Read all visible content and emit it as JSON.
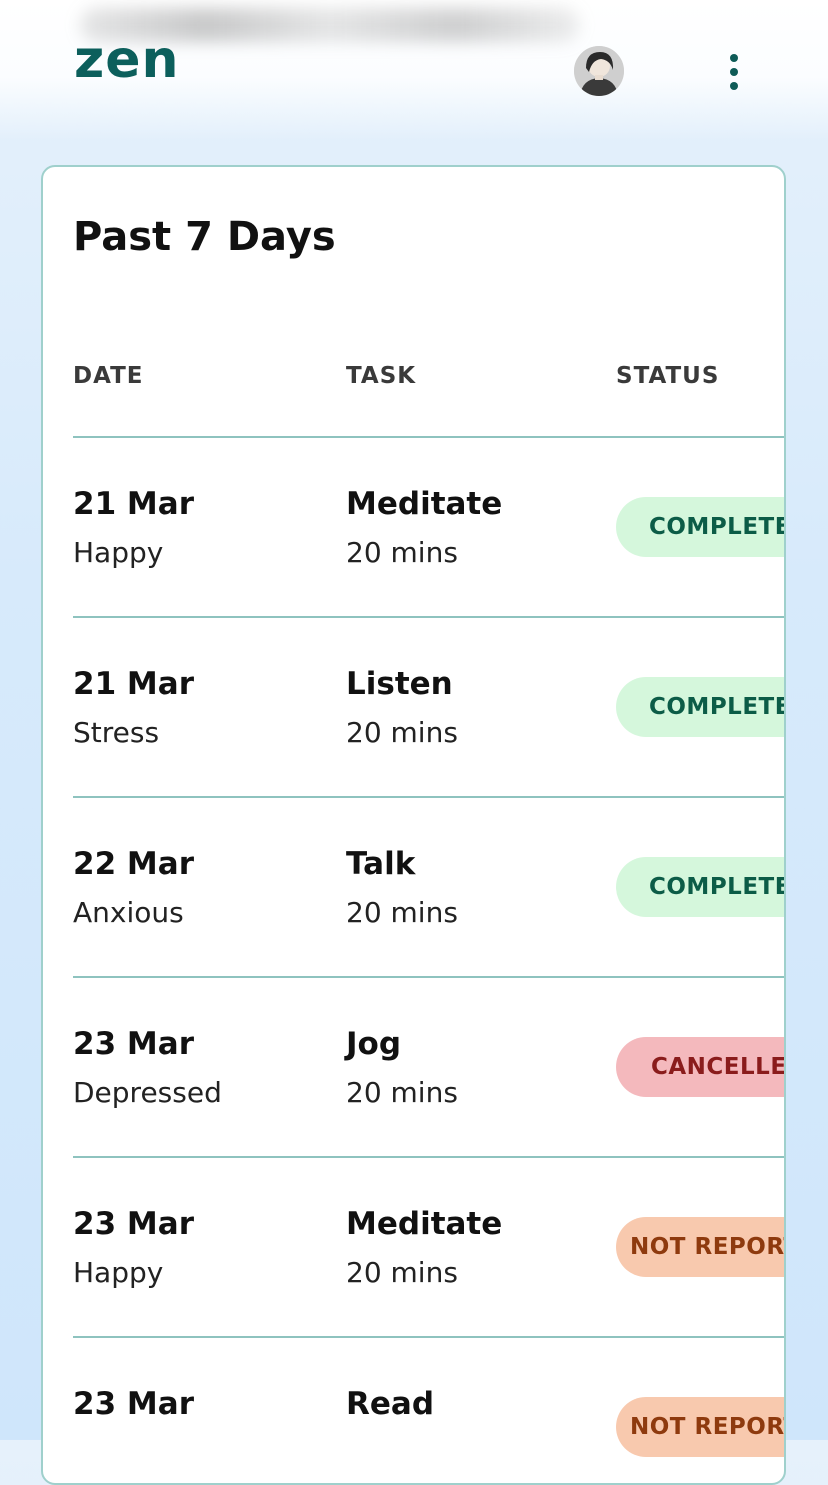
{
  "app": {
    "logo_text": "zen",
    "brand_color": "#0c5f5c"
  },
  "header": {
    "avatar_icon": "user-avatar",
    "menu_icon": "more-vertical-icon"
  },
  "card": {
    "title": "Past 7 Days",
    "columns": {
      "date": "DATE",
      "task": "TASK",
      "status": "STATUS"
    },
    "rows": [
      {
        "date": "21 Mar",
        "mood": "Happy",
        "task": "Meditate",
        "duration": "20 mins",
        "status": "COMPLETED",
        "status_type": "completed"
      },
      {
        "date": "21 Mar",
        "mood": "Stress",
        "task": "Listen",
        "duration": "20 mins",
        "status": "COMPLETED",
        "status_type": "completed"
      },
      {
        "date": "22 Mar",
        "mood": "Anxious",
        "task": "Talk",
        "duration": "20 mins",
        "status": "COMPLETED",
        "status_type": "completed"
      },
      {
        "date": "23 Mar",
        "mood": "Depressed",
        "task": "Jog",
        "duration": "20 mins",
        "status": "CANCELLED",
        "status_type": "cancelled"
      },
      {
        "date": "23 Mar",
        "mood": "Happy",
        "task": "Meditate",
        "duration": "20 mins",
        "status": "NOT REPORTED",
        "status_type": "not-reported"
      },
      {
        "date": "23 Mar",
        "mood": "",
        "task": "Read",
        "duration": "",
        "status": "NOT REPORTED",
        "status_type": "not-reported"
      }
    ]
  },
  "status_colors": {
    "completed_bg": "#d5f7dc",
    "completed_text": "#0c5c47",
    "cancelled_bg": "#f4b9bd",
    "cancelled_text": "#8a1c1c",
    "not_reported_bg": "#f8c9ae",
    "not_reported_text": "#8e3a0e"
  }
}
